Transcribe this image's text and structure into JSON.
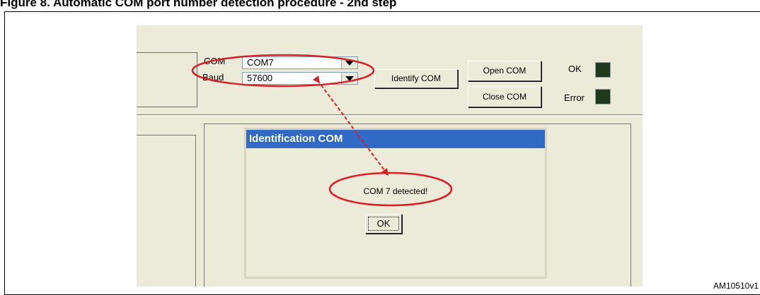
{
  "figure": {
    "title": "Figure 8.     Automatic COM port number detection procedure - 2nd step",
    "id": "AM10510v1"
  },
  "toolbar": {
    "com_label": "COM",
    "com_value": "COM7",
    "baud_label": "Baud",
    "baud_value": "57600",
    "identify_button": "Identify COM",
    "open_button": "Open COM",
    "close_button": "Close COM",
    "ok_label": "OK",
    "error_label": "Error"
  },
  "dialog": {
    "title": "Identification COM",
    "message": "COM 7 detected!",
    "ok_button": "OK"
  },
  "colors": {
    "dialog_title_bar": "#316ac5",
    "window_bg": "#ecead8",
    "led_off": "#1d3a1f",
    "annotation": "#d91f26"
  }
}
